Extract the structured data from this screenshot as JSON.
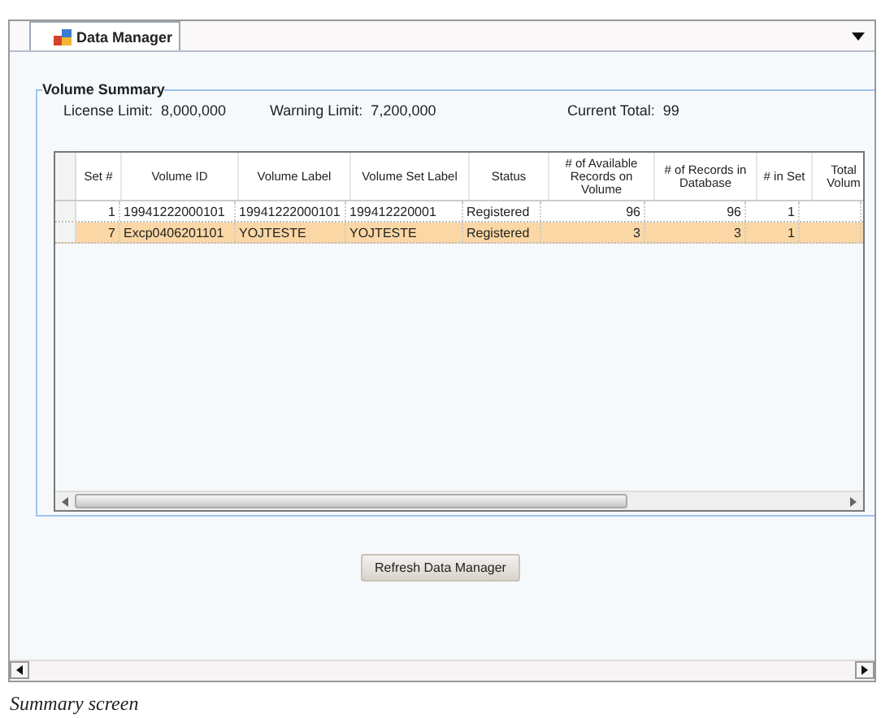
{
  "tab": {
    "label": "Data Manager",
    "selected": true
  },
  "group": {
    "title": "Volume Summary",
    "stats": [
      {
        "label": "License Limit:",
        "value": "8,000,000"
      },
      {
        "label": "Warning Limit:",
        "value": "7,200,000"
      },
      {
        "label": "Current Total:",
        "value": "99"
      }
    ]
  },
  "table": {
    "columns": [
      "Set #",
      "Volume ID",
      "Volume Label",
      "Volume Set Label",
      "Status",
      "# of Available Records on Volume",
      "# of Records in Database",
      "# in Set",
      "Total Volum"
    ],
    "rows": [
      {
        "selected": false,
        "cells": [
          "1",
          "19941222000101",
          "19941222000101",
          "199412220001",
          "Registered",
          "96",
          "96",
          "1",
          ""
        ]
      },
      {
        "selected": true,
        "cells": [
          "7",
          "Excp0406201101",
          "YOJTESTE",
          "YOJTESTE",
          "Registered",
          "3",
          "3",
          "1",
          ""
        ]
      }
    ]
  },
  "button": {
    "label": "Refresh Data Manager"
  },
  "caption": "Summary screen"
}
